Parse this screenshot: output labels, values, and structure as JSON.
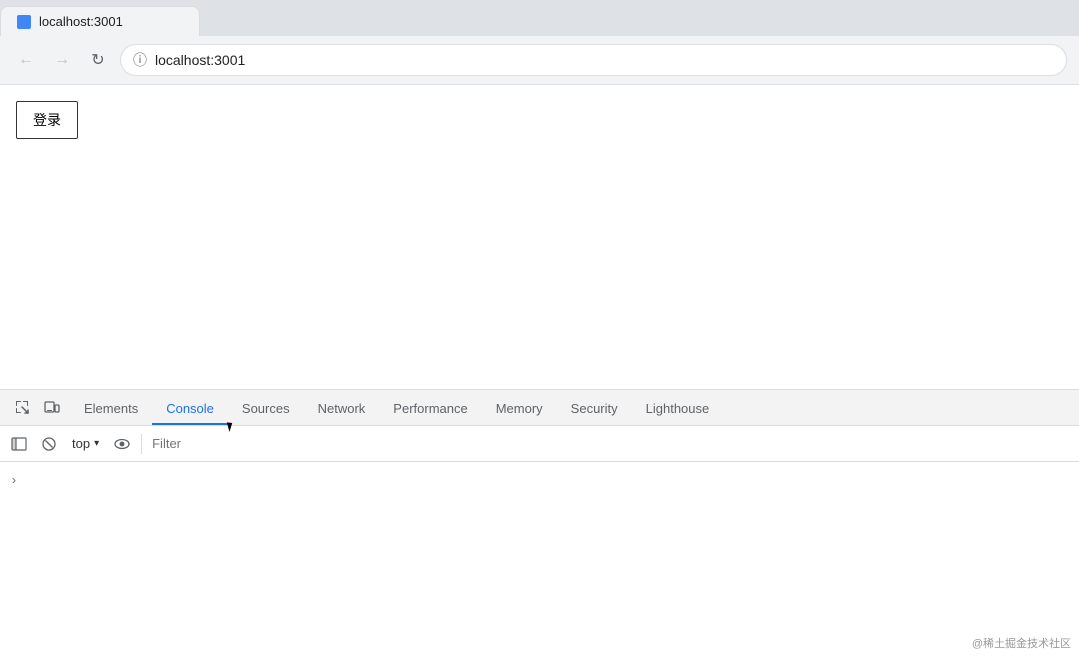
{
  "browser": {
    "tab_title": "localhost:3001",
    "address": "localhost:3001",
    "back_btn": "←",
    "forward_btn": "→",
    "reload_btn": "↻"
  },
  "page": {
    "login_button": "登录"
  },
  "devtools": {
    "tabs": [
      {
        "id": "elements",
        "label": "Elements",
        "active": false
      },
      {
        "id": "console",
        "label": "Console",
        "active": true
      },
      {
        "id": "sources",
        "label": "Sources",
        "active": false
      },
      {
        "id": "network",
        "label": "Network",
        "active": false
      },
      {
        "id": "performance",
        "label": "Performance",
        "active": false
      },
      {
        "id": "memory",
        "label": "Memory",
        "active": false
      },
      {
        "id": "security",
        "label": "Security",
        "active": false
      },
      {
        "id": "lighthouse",
        "label": "Lighthouse",
        "active": false
      }
    ],
    "toolbar": {
      "top_label": "top",
      "filter_placeholder": "Filter"
    }
  },
  "watermark": "@稀土掘金技术社区"
}
